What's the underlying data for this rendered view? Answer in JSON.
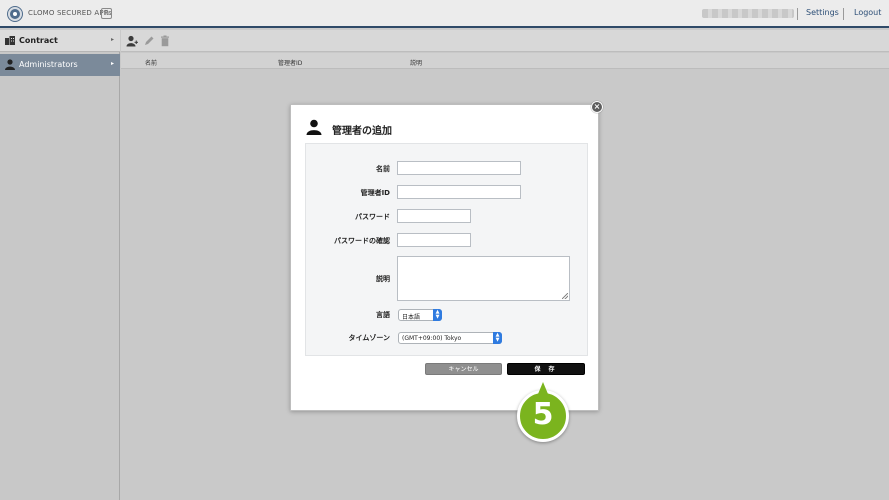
{
  "topbar": {
    "app_title": "CLOMO SECURED APPs",
    "settings_label": "Settings",
    "logout_label": "Logout"
  },
  "sidebar": {
    "items": [
      {
        "label": "Contract",
        "icon": "building-icon",
        "selected": false
      },
      {
        "label": "Administrators",
        "icon": "person-icon",
        "selected": true
      }
    ]
  },
  "toolbar": {
    "icons": [
      "add-person-icon",
      "edit-pencil-icon",
      "trash-icon"
    ]
  },
  "table": {
    "columns": [
      "名前",
      "管理者ID",
      "説明"
    ]
  },
  "dialog": {
    "title": "管理者の追加",
    "fields": {
      "name_label": "名前",
      "name_value": "",
      "admin_id_label": "管理者ID",
      "admin_id_value": "",
      "password_label": "パスワード",
      "password_value": "",
      "password_confirm_label": "パスワードの確認",
      "password_confirm_value": "",
      "description_label": "説明",
      "description_value": "",
      "language_label": "言語",
      "language_value": "日本語",
      "timezone_label": "タイムゾーン",
      "timezone_value": "(GMT+09:00) Tokyo"
    },
    "cancel_label": "キャンセル",
    "save_label": "保 存"
  },
  "step_badge": {
    "number": "5",
    "color": "#7bb41e"
  },
  "colors": {
    "topbar_border": "#2f4a68",
    "sidebar_selected": "#7b8a9a",
    "select_arrow": "#2f7be0"
  }
}
